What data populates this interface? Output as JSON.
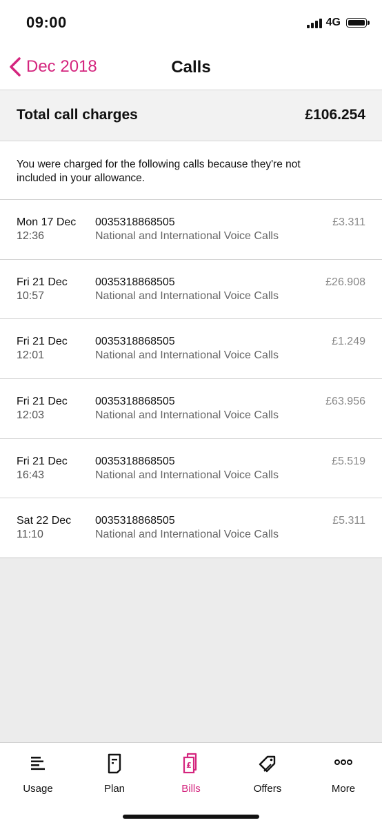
{
  "status": {
    "time": "09:00",
    "network": "4G"
  },
  "nav": {
    "back_label": "Dec 2018",
    "title": "Calls"
  },
  "summary": {
    "label": "Total call charges",
    "value": "£106.254"
  },
  "notice": "You were charged for the following calls because they're not included in your allowance.",
  "calls": [
    {
      "date": "Mon 17 Dec",
      "time": "12:36",
      "number": "0035318868505",
      "type": "National and International Voice Calls",
      "amount": "£3.311"
    },
    {
      "date": "Fri 21 Dec",
      "time": "10:57",
      "number": "0035318868505",
      "type": "National and International Voice Calls",
      "amount": "£26.908"
    },
    {
      "date": "Fri 21 Dec",
      "time": "12:01",
      "number": "0035318868505",
      "type": "National and International Voice Calls",
      "amount": "£1.249"
    },
    {
      "date": "Fri 21 Dec",
      "time": "12:03",
      "number": "0035318868505",
      "type": "National and International Voice Calls",
      "amount": "£63.956"
    },
    {
      "date": "Fri 21 Dec",
      "time": "16:43",
      "number": "0035318868505",
      "type": "National and International Voice Calls",
      "amount": "£5.519"
    },
    {
      "date": "Sat 22 Dec",
      "time": "11:10",
      "number": "0035318868505",
      "type": "National and International Voice Calls",
      "amount": "£5.311"
    }
  ],
  "tabs": [
    {
      "label": "Usage",
      "icon": "usage-icon",
      "active": false
    },
    {
      "label": "Plan",
      "icon": "plan-icon",
      "active": false
    },
    {
      "label": "Bills",
      "icon": "bills-icon",
      "active": true
    },
    {
      "label": "Offers",
      "icon": "offers-icon",
      "active": false
    },
    {
      "label": "More",
      "icon": "more-icon",
      "active": false
    }
  ],
  "colors": {
    "accent": "#d4257e",
    "background": "#ececec"
  }
}
